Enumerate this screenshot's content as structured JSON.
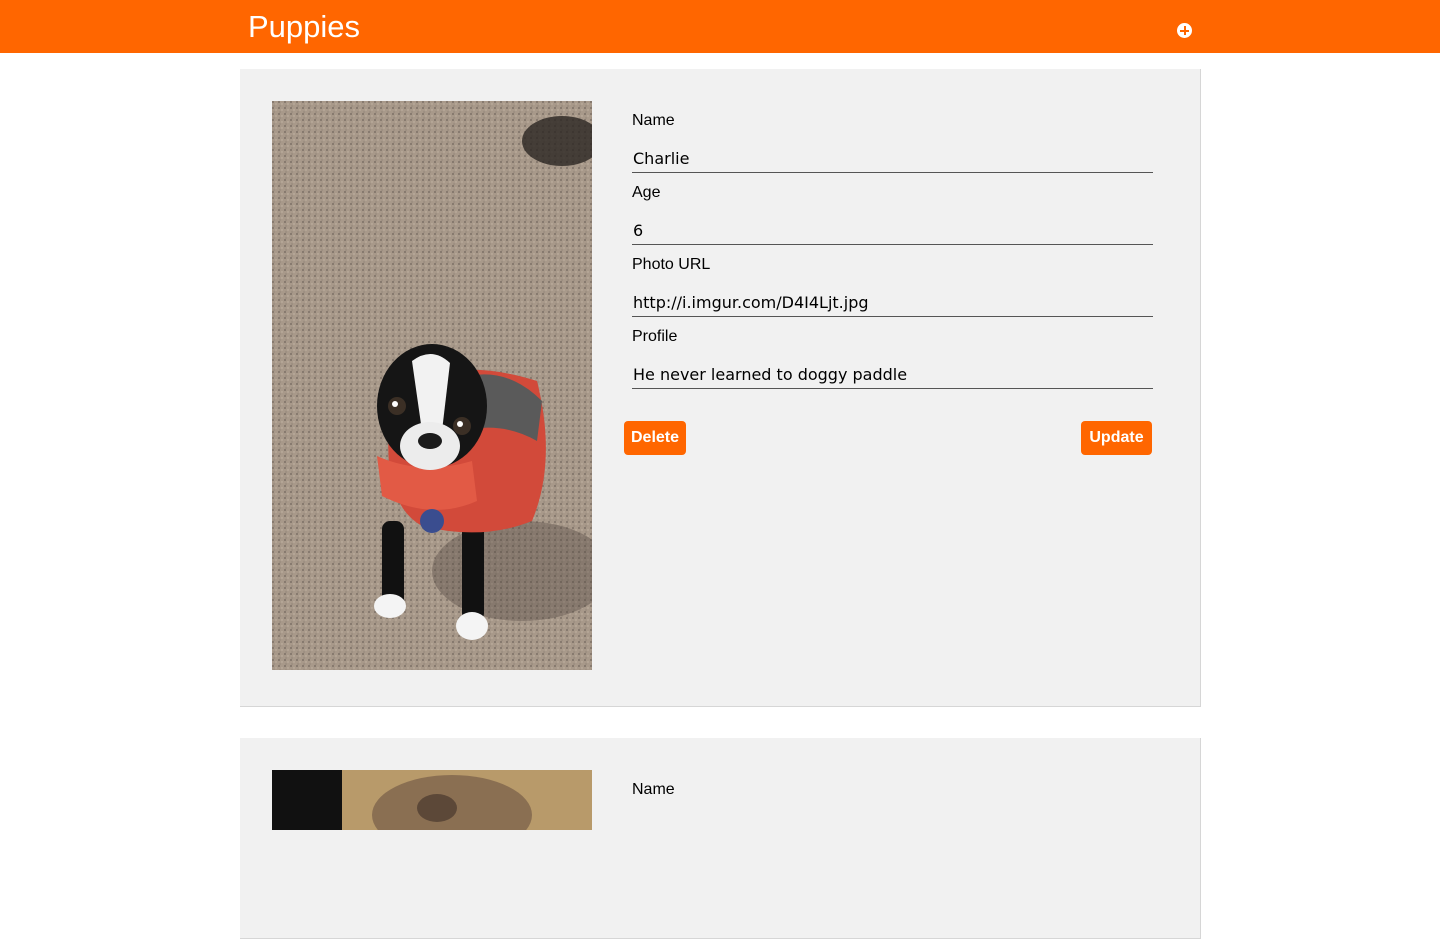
{
  "header": {
    "title": "Puppies",
    "add_icon": "plus-circle-icon",
    "color": "#ff6600"
  },
  "puppies": [
    {
      "photo": "boston-terrier-in-red-life-vest",
      "name_label": "Name",
      "name": "Charlie",
      "age_label": "Age",
      "age": "6",
      "photo_url_label": "Photo URL",
      "photo_url": "http://i.imgur.com/D4I4Ljt.jpg",
      "profile_label": "Profile",
      "profile": "He never learned to doggy paddle",
      "delete_label": "Delete",
      "update_label": "Update"
    },
    {
      "photo": "brown-dog",
      "name_label": "Name"
    }
  ]
}
